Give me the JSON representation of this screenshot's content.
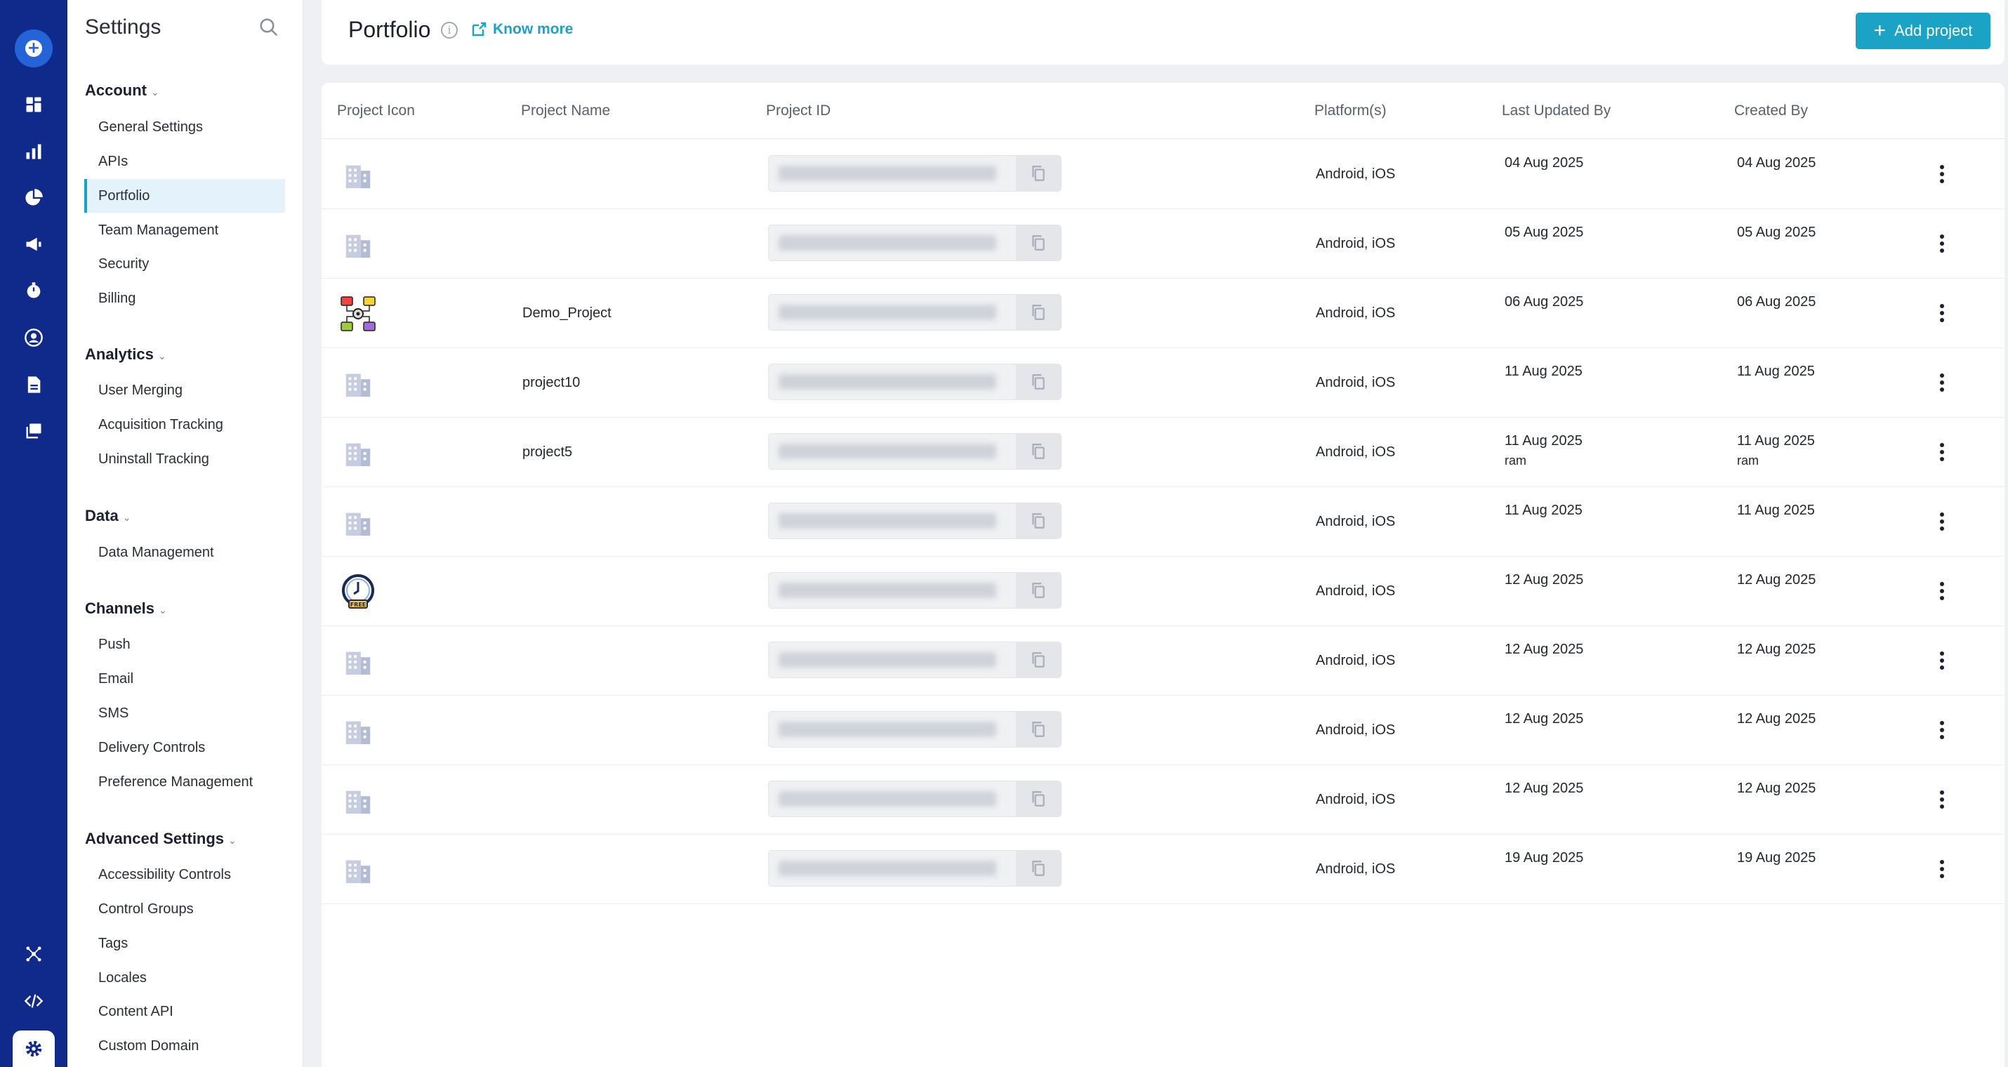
{
  "settings": {
    "title": "Settings",
    "groups": [
      {
        "label": "Account",
        "items": [
          "General Settings",
          "APIs",
          "Portfolio",
          "Team Management",
          "Security",
          "Billing"
        ]
      },
      {
        "label": "Analytics",
        "items": [
          "User Merging",
          "Acquisition Tracking",
          "Uninstall Tracking"
        ]
      },
      {
        "label": "Data",
        "items": [
          "Data Management"
        ]
      },
      {
        "label": "Channels",
        "items": [
          "Push",
          "Email",
          "SMS",
          "Delivery Controls",
          "Preference Management"
        ]
      },
      {
        "label": "Advanced Settings",
        "items": [
          "Accessibility Controls",
          "Control Groups",
          "Tags",
          "Locales",
          "Content API",
          "Custom Domain"
        ]
      }
    ],
    "active_item": "Portfolio"
  },
  "header": {
    "title": "Portfolio",
    "know_more": "Know more",
    "add_project": "Add project"
  },
  "table": {
    "columns": [
      "Project Icon",
      "Project Name",
      "Project ID",
      "Platform(s)",
      "Last Updated By",
      "Created By"
    ],
    "rows": [
      {
        "icon": "building-icon",
        "name": "",
        "platforms": "Android, iOS",
        "updated": "04 Aug 2025",
        "updated_by": "",
        "created": "04 Aug 2025",
        "created_by": ""
      },
      {
        "icon": "building-icon",
        "name": "",
        "platforms": "Android, iOS",
        "updated": "05 Aug 2025",
        "updated_by": "",
        "created": "05 Aug 2025",
        "created_by": ""
      },
      {
        "icon": "flowchart-icon",
        "name": "Demo_Project",
        "platforms": "Android, iOS",
        "updated": "06 Aug 2025",
        "updated_by": "",
        "created": "06 Aug 2025",
        "created_by": ""
      },
      {
        "icon": "building-icon",
        "name": "project10",
        "platforms": "Android, iOS",
        "updated": "11 Aug 2025",
        "updated_by": "",
        "created": "11 Aug 2025",
        "created_by": ""
      },
      {
        "icon": "building-icon",
        "name": "project5",
        "platforms": "Android, iOS",
        "updated": "11 Aug 2025",
        "updated_by": "ram",
        "created": "11 Aug 2025",
        "created_by": "ram"
      },
      {
        "icon": "building-icon",
        "name": "",
        "platforms": "Android, iOS",
        "updated": "11 Aug 2025",
        "updated_by": "",
        "created": "11 Aug 2025",
        "created_by": ""
      },
      {
        "icon": "clock-badge-icon",
        "name": "",
        "platforms": "Android, iOS",
        "updated": "12 Aug 2025",
        "updated_by": "",
        "created": "12 Aug 2025",
        "created_by": ""
      },
      {
        "icon": "building-icon",
        "name": "",
        "platforms": "Android, iOS",
        "updated": "12 Aug 2025",
        "updated_by": "",
        "created": "12 Aug 2025",
        "created_by": ""
      },
      {
        "icon": "building-icon",
        "name": "",
        "platforms": "Android, iOS",
        "updated": "12 Aug 2025",
        "updated_by": "",
        "created": "12 Aug 2025",
        "created_by": ""
      },
      {
        "icon": "building-icon",
        "name": "",
        "platforms": "Android, iOS",
        "updated": "12 Aug 2025",
        "updated_by": "",
        "created": "12 Aug 2025",
        "created_by": ""
      },
      {
        "icon": "building-icon",
        "name": "",
        "platforms": "Android, iOS",
        "updated": "19 Aug 2025",
        "updated_by": "",
        "created": "19 Aug 2025",
        "created_by": ""
      }
    ]
  },
  "colors": {
    "rail": "#0f2a8a",
    "accent": "#1aa3c4",
    "active_bg": "#e3f2fb"
  }
}
